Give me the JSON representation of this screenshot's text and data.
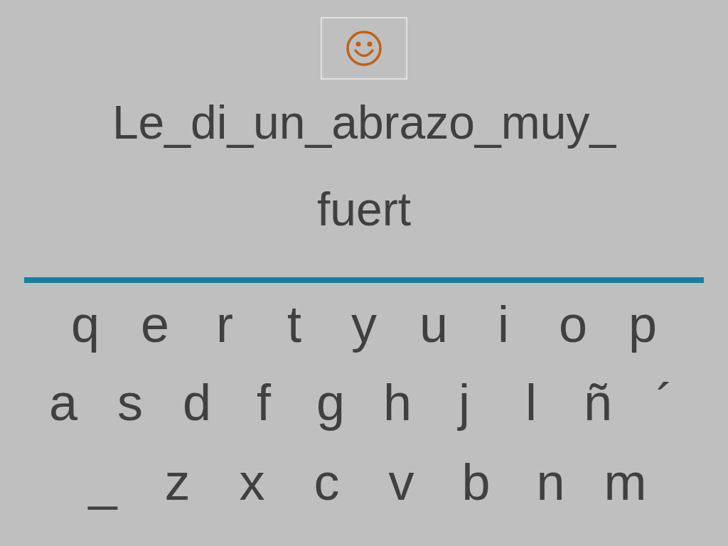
{
  "phrase": {
    "lines": [
      "Le_di_un_abrazo_muy_",
      "fuert"
    ]
  },
  "keyboard": {
    "rows": [
      [
        "q",
        "e",
        "r",
        "t",
        "y",
        "u",
        "i",
        "o",
        "p"
      ],
      [
        "a",
        "s",
        "d",
        "f",
        "g",
        "h",
        "j",
        "l",
        "ñ",
        "´"
      ],
      [
        "_",
        "z",
        "x",
        "c",
        "v",
        "b",
        "n",
        "m"
      ]
    ]
  }
}
